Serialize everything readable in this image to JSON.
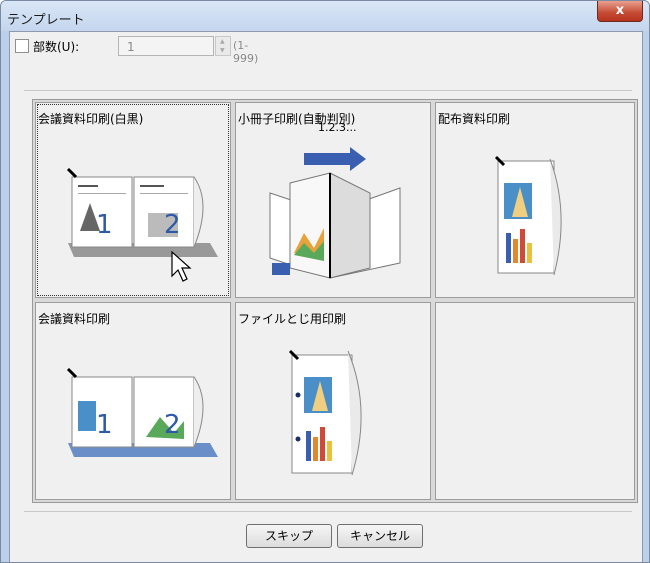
{
  "window": {
    "title": "テンプレート",
    "close_label": "x"
  },
  "copies": {
    "label": "部数(U):",
    "value": "1",
    "range": "(1-999)"
  },
  "templates": [
    {
      "label": "会議資料印刷(白黒)",
      "icon": "booklet-bw-icon"
    },
    {
      "label": "小冊子印刷(自動判別)",
      "icon": "booklet-fold-icon",
      "caption": "1.2.3..."
    },
    {
      "label": "配布資料印刷",
      "icon": "handout-icon"
    },
    {
      "label": "会議資料印刷",
      "icon": "booklet-color-icon"
    },
    {
      "label": "ファイルとじ用印刷",
      "icon": "punch-hole-icon"
    },
    {
      "label": "",
      "icon": ""
    }
  ],
  "buttons": {
    "skip": "スキップ",
    "cancel": "キャンセル"
  },
  "colors": {
    "titlebar": "#c4d6ee",
    "close": "#c44a33",
    "accent_blue": "#3a5fb0"
  }
}
